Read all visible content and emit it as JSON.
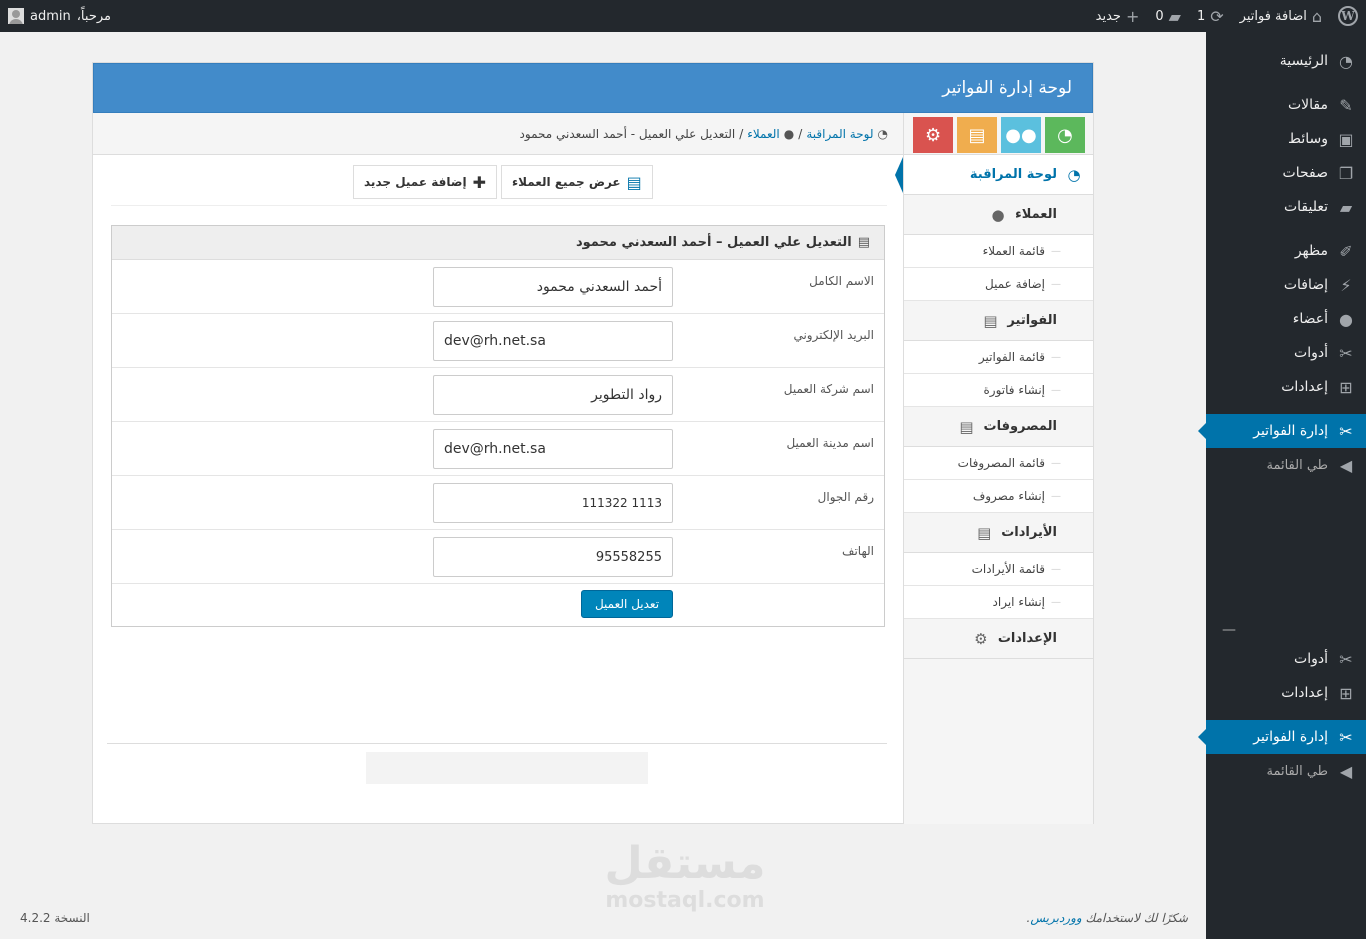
{
  "adminbar": {
    "site_name": "اضافة فواتير",
    "updates_count": "1",
    "comments_count": "0",
    "new_label": "جديد",
    "greeting": "مرحباً،",
    "user": "admin"
  },
  "menu": {
    "items": [
      {
        "label": "الرئيسية",
        "icon": "dashboard-icon"
      },
      {
        "label": "مقالات",
        "icon": "pin-icon"
      },
      {
        "label": "وسائط",
        "icon": "media-icon"
      },
      {
        "label": "صفحات",
        "icon": "pages-icon"
      },
      {
        "label": "تعليقات",
        "icon": "comments-icon"
      },
      {
        "label": "مظهر",
        "icon": "appearance-icon"
      },
      {
        "label": "إضافات",
        "icon": "plugins-icon"
      },
      {
        "label": "أعضاء",
        "icon": "users-icon"
      },
      {
        "label": "أدوات",
        "icon": "tools-icon"
      },
      {
        "label": "إعدادات",
        "icon": "settings-icon"
      },
      {
        "label": "إدارة الفواتير",
        "icon": "tools-icon"
      },
      {
        "label": "طي القائمة",
        "icon": "collapse-icon"
      },
      {
        "label": "—",
        "icon": ""
      },
      {
        "label": "أدوات",
        "icon": "tools-icon"
      },
      {
        "label": "إعدادات",
        "icon": "settings-icon"
      },
      {
        "label": "إدارة الفواتير",
        "icon": "tools-icon"
      },
      {
        "label": "طي القائمة",
        "icon": "collapse-icon"
      }
    ]
  },
  "panel": {
    "title": "لوحة إدارة الفواتير"
  },
  "breadcrumb": {
    "home": "لوحة المراقبة",
    "sep": "/",
    "clients": "العملاء",
    "current": "التعديل علي العميل - أحمد السعدني محمود"
  },
  "sidebar": {
    "dashboard": "لوحة المراقبة",
    "clients": "العملاء",
    "clients_list": "قائمة العملاء",
    "add_client": "إضافة عميل",
    "invoices": "الفواتير",
    "invoices_list": "قائمة الفواتير",
    "create_invoice": "إنشاء فاتورة",
    "expenses": "المصروفات",
    "expenses_list": "قائمة المصروفات",
    "create_expense": "إنشاء مصروف",
    "revenues": "الأيرادات",
    "revenues_list": "قائمة الأيرادات",
    "create_revenue": "إنشاء ايراد",
    "settings": "الإعدادات"
  },
  "actions": {
    "view_all": "عرض جميع العملاء",
    "add_new": "إضافة عميل جديد"
  },
  "form": {
    "heading": "التعديل علي العميل – أحمد السعدني محمود",
    "full_name_label": "الاسم الكامل",
    "full_name_value": "أحمد السعدني محمود",
    "email_label": "البريد الإلكتروني",
    "email_value": "dev@rh.net.sa",
    "company_label": "اسم شركة العميل",
    "company_value": "رواد التطوير",
    "city_label": "اسم مدينة العميل",
    "city_value": "dev@rh.net.sa",
    "mobile_label": "رقم الجوال",
    "mobile_value": "1113 111322",
    "phone_label": "الهاتف",
    "phone_value": "95558255",
    "submit": "تعديل العميل"
  },
  "footer": {
    "thanks_prefix": "شكرًا لك لاستخدامك",
    "thanks_link": "ووردبريس",
    "thanks_suffix": ".",
    "version": "النسخة 4.2.2"
  },
  "watermark": {
    "arabic": "مستقل",
    "latin": "mostaql.com"
  },
  "colors": {
    "accent": "#0073aa",
    "panel_head": "#428bca",
    "admin_dark": "#23282d",
    "btn_green": "#5cb85c",
    "btn_blue": "#5bc0de",
    "btn_yellow": "#f0ad4e",
    "btn_red": "#d9534f"
  }
}
